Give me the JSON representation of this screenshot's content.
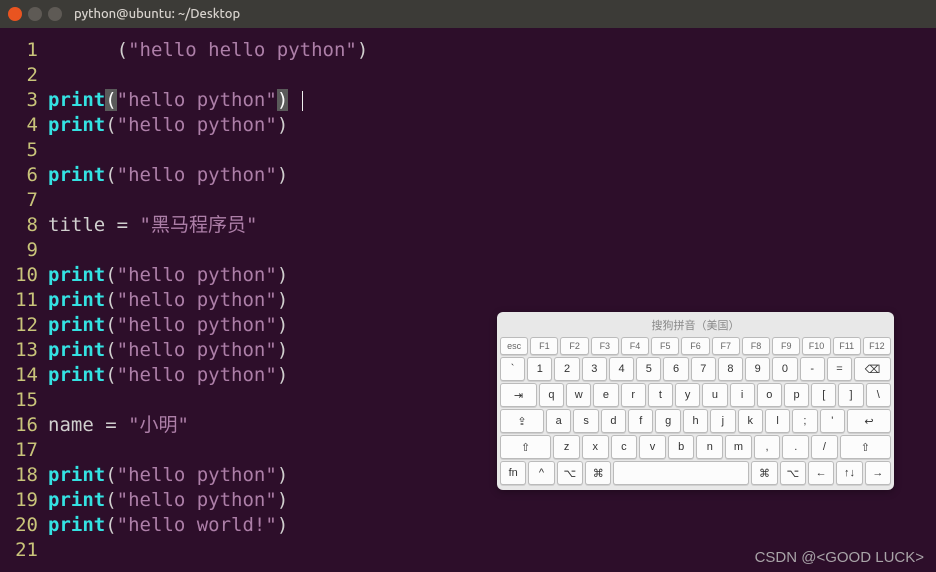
{
  "window": {
    "title": "python@ubuntu: ~/Desktop"
  },
  "code_lines": [
    {
      "n": 1,
      "segments": [
        {
          "t": "plain",
          "v": "      "
        },
        {
          "t": "paren",
          "v": "("
        },
        {
          "t": "str",
          "v": "\"hello hello python\""
        },
        {
          "t": "paren",
          "v": ")"
        }
      ]
    },
    {
      "n": 2,
      "segments": []
    },
    {
      "n": 3,
      "segments": [
        {
          "t": "kw",
          "v": "print"
        },
        {
          "t": "paren_hl",
          "v": "("
        },
        {
          "t": "str",
          "v": "\"hello python\""
        },
        {
          "t": "paren_hl",
          "v": ")"
        },
        {
          "t": "cursor",
          "v": ""
        }
      ]
    },
    {
      "n": 4,
      "segments": [
        {
          "t": "kw",
          "v": "print"
        },
        {
          "t": "paren",
          "v": "("
        },
        {
          "t": "str",
          "v": "\"hello python\""
        },
        {
          "t": "paren",
          "v": ")"
        }
      ]
    },
    {
      "n": 5,
      "segments": []
    },
    {
      "n": 6,
      "segments": [
        {
          "t": "kw",
          "v": "print"
        },
        {
          "t": "paren",
          "v": "("
        },
        {
          "t": "str",
          "v": "\"hello python\""
        },
        {
          "t": "paren",
          "v": ")"
        }
      ]
    },
    {
      "n": 7,
      "segments": []
    },
    {
      "n": 8,
      "segments": [
        {
          "t": "plain",
          "v": "title = "
        },
        {
          "t": "str",
          "v": "\"黑马程序员\""
        }
      ]
    },
    {
      "n": 9,
      "segments": []
    },
    {
      "n": 10,
      "segments": [
        {
          "t": "kw",
          "v": "print"
        },
        {
          "t": "paren",
          "v": "("
        },
        {
          "t": "str",
          "v": "\"hello python\""
        },
        {
          "t": "paren",
          "v": ")"
        }
      ]
    },
    {
      "n": 11,
      "segments": [
        {
          "t": "kw",
          "v": "print"
        },
        {
          "t": "paren",
          "v": "("
        },
        {
          "t": "str",
          "v": "\"hello python\""
        },
        {
          "t": "paren",
          "v": ")"
        }
      ]
    },
    {
      "n": 12,
      "segments": [
        {
          "t": "kw",
          "v": "print"
        },
        {
          "t": "paren",
          "v": "("
        },
        {
          "t": "str",
          "v": "\"hello python\""
        },
        {
          "t": "paren",
          "v": ")"
        }
      ]
    },
    {
      "n": 13,
      "segments": [
        {
          "t": "kw",
          "v": "print"
        },
        {
          "t": "paren",
          "v": "("
        },
        {
          "t": "str",
          "v": "\"hello python\""
        },
        {
          "t": "paren",
          "v": ")"
        }
      ]
    },
    {
      "n": 14,
      "segments": [
        {
          "t": "kw",
          "v": "print"
        },
        {
          "t": "paren",
          "v": "("
        },
        {
          "t": "str",
          "v": "\"hello python\""
        },
        {
          "t": "paren",
          "v": ")"
        }
      ]
    },
    {
      "n": 15,
      "segments": []
    },
    {
      "n": 16,
      "segments": [
        {
          "t": "plain",
          "v": "name = "
        },
        {
          "t": "str",
          "v": "\"小明\""
        }
      ]
    },
    {
      "n": 17,
      "segments": []
    },
    {
      "n": 18,
      "segments": [
        {
          "t": "kw",
          "v": "print"
        },
        {
          "t": "paren",
          "v": "("
        },
        {
          "t": "str",
          "v": "\"hello python\""
        },
        {
          "t": "paren",
          "v": ")"
        }
      ]
    },
    {
      "n": 19,
      "segments": [
        {
          "t": "kw",
          "v": "print"
        },
        {
          "t": "paren",
          "v": "("
        },
        {
          "t": "str",
          "v": "\"hello python\""
        },
        {
          "t": "paren",
          "v": ")"
        }
      ]
    },
    {
      "n": 20,
      "segments": [
        {
          "t": "kw",
          "v": "print"
        },
        {
          "t": "paren",
          "v": "("
        },
        {
          "t": "str",
          "v": "\"hello world!\""
        },
        {
          "t": "paren",
          "v": ")"
        }
      ]
    },
    {
      "n": 21,
      "segments": []
    }
  ],
  "osk": {
    "title": "搜狗拼音（美国）",
    "rows": [
      [
        "esc",
        "F1",
        "F2",
        "F3",
        "F4",
        "F5",
        "F6",
        "F7",
        "F8",
        "F9",
        "F10",
        "F11",
        "F12"
      ],
      [
        "`",
        "1",
        "2",
        "3",
        "4",
        "5",
        "6",
        "7",
        "8",
        "9",
        "0",
        "-",
        "=",
        "⌫"
      ],
      [
        "⇥",
        "q",
        "w",
        "e",
        "r",
        "t",
        "y",
        "u",
        "i",
        "o",
        "p",
        "[",
        "]",
        "\\"
      ],
      [
        "⇪",
        "a",
        "s",
        "d",
        "f",
        "g",
        "h",
        "j",
        "k",
        "l",
        ";",
        "'",
        "↩"
      ],
      [
        "⇧",
        "z",
        "x",
        "c",
        "v",
        "b",
        "n",
        "m",
        ",",
        ".",
        "/",
        "⇧"
      ],
      [
        "fn",
        "^",
        "⌥",
        "⌘",
        " ",
        "⌘",
        "⌥",
        "←",
        "↑↓",
        "→"
      ]
    ]
  },
  "watermark": "CSDN @<GOOD LUCK>"
}
